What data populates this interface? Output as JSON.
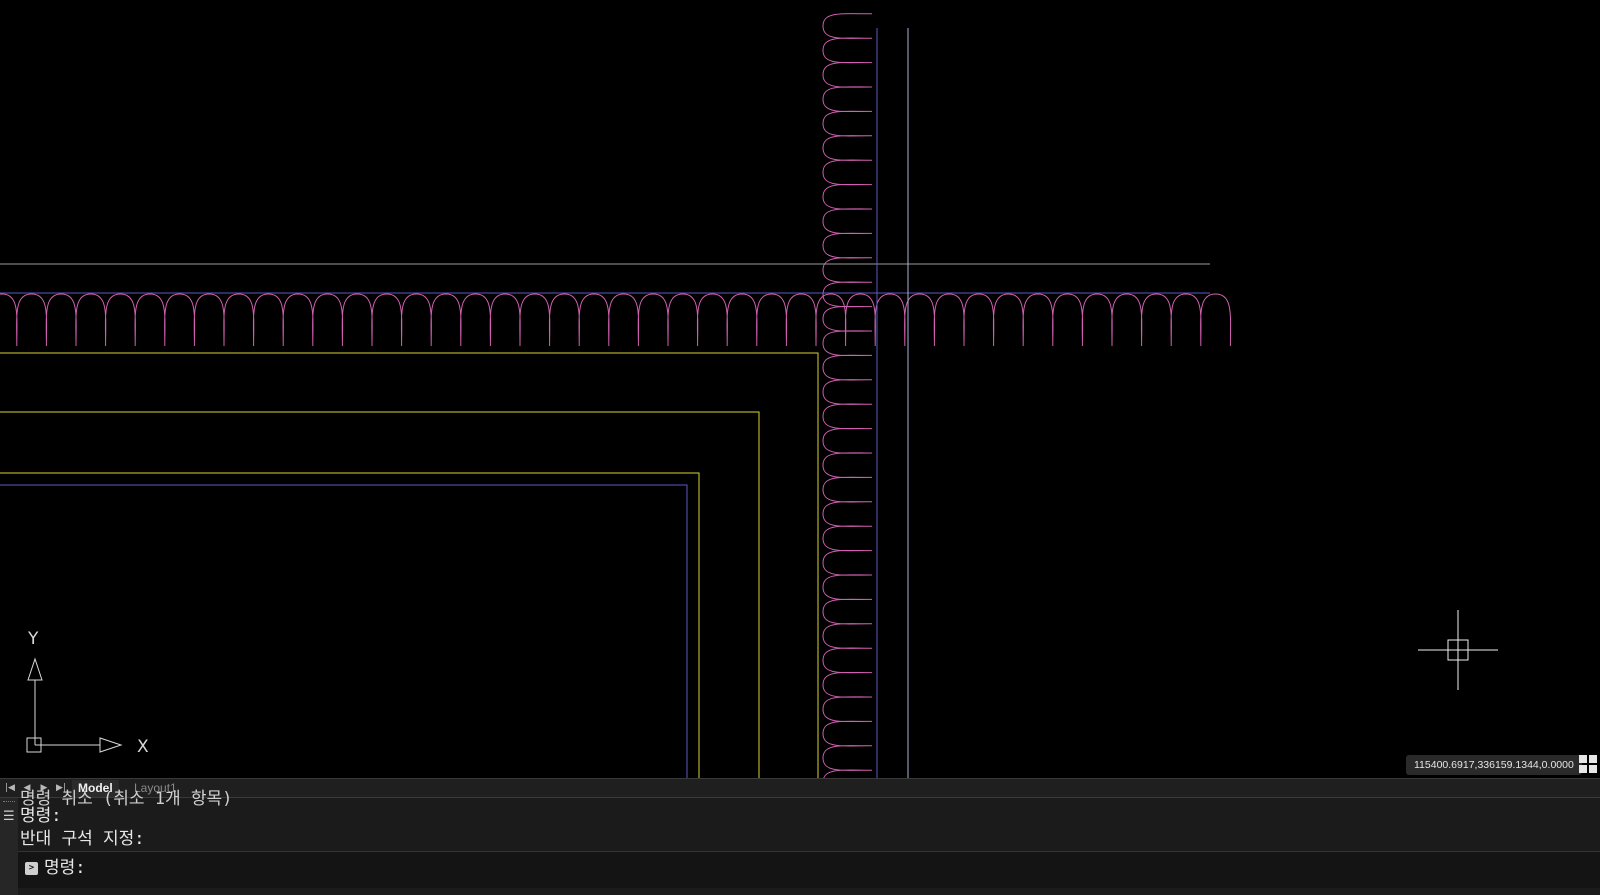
{
  "colors": {
    "insulation": "#d060b0",
    "yellow": "#d8d430",
    "blue": "#5a5ac8",
    "gray": "#9a9a9a",
    "lightblue": "#a8b4d8",
    "ucs": "#d8d8d8",
    "crosshair": "#f0f0f0"
  },
  "ucs": {
    "x_label": "X",
    "y_label": "Y"
  },
  "status": {
    "coordinates": "115400.6917,336159.1344,0.0000"
  },
  "tabs": [
    {
      "label": "Model",
      "active": true
    },
    {
      "label": "Layout1",
      "active": false
    }
  ],
  "nav": {
    "first": "|◀",
    "prev": "◀",
    "next": "▶",
    "last": "▶|"
  },
  "command_line": {
    "history": [
      "명령 취소 (취소 1개 항목)",
      "명령:",
      "반대 구석 지정:"
    ],
    "prompt": "명령:",
    "input_value": ""
  }
}
